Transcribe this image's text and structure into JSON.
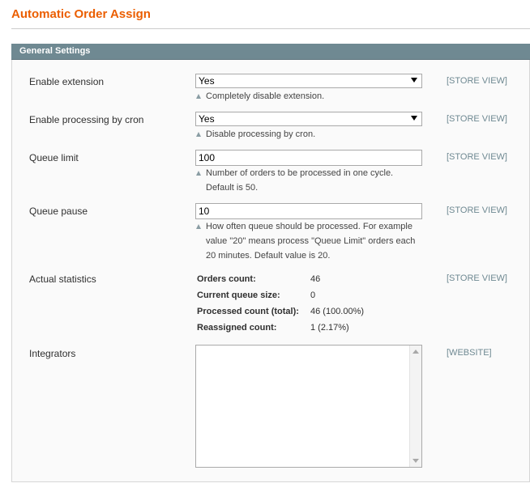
{
  "page": {
    "title": "Automatic Order Assign"
  },
  "section": {
    "title": "General Settings"
  },
  "fields": {
    "enable_extension": {
      "label": "Enable extension",
      "value": "Yes",
      "note": "Completely disable extension.",
      "scope": "[STORE VIEW]"
    },
    "enable_cron": {
      "label": "Enable processing by cron",
      "value": "Yes",
      "note": "Disable processing by cron.",
      "scope": "[STORE VIEW]"
    },
    "queue_limit": {
      "label": "Queue limit",
      "value": "100",
      "note_line1": "Number of orders to be processed in one cycle.",
      "note_line2": "Default is 50.",
      "scope": "[STORE VIEW]"
    },
    "queue_pause": {
      "label": "Queue pause",
      "value": "10",
      "note_line1": "How often queue should be processed. For example",
      "note_line2": "value \"20\" means process \"Queue Limit\" orders each",
      "note_line3": "20 minutes. Default value is 20.",
      "scope": "[STORE VIEW]"
    },
    "statistics": {
      "label": "Actual statistics",
      "scope": "[STORE VIEW]",
      "orders_count_label": "Orders count:",
      "orders_count_value": "46",
      "queue_size_label": "Current queue size:",
      "queue_size_value": "0",
      "processed_label": "Processed count (total):",
      "processed_value": "46 (100.00%)",
      "reassigned_label": "Reassigned count:",
      "reassigned_value": "1 (2.17%)"
    },
    "integrators": {
      "label": "Integrators",
      "value": "",
      "scope": "[WEBSITE]"
    }
  },
  "colors": {
    "title": "#eb5e00",
    "section_header": "#6f8992",
    "scope_text": "#6f8992"
  }
}
